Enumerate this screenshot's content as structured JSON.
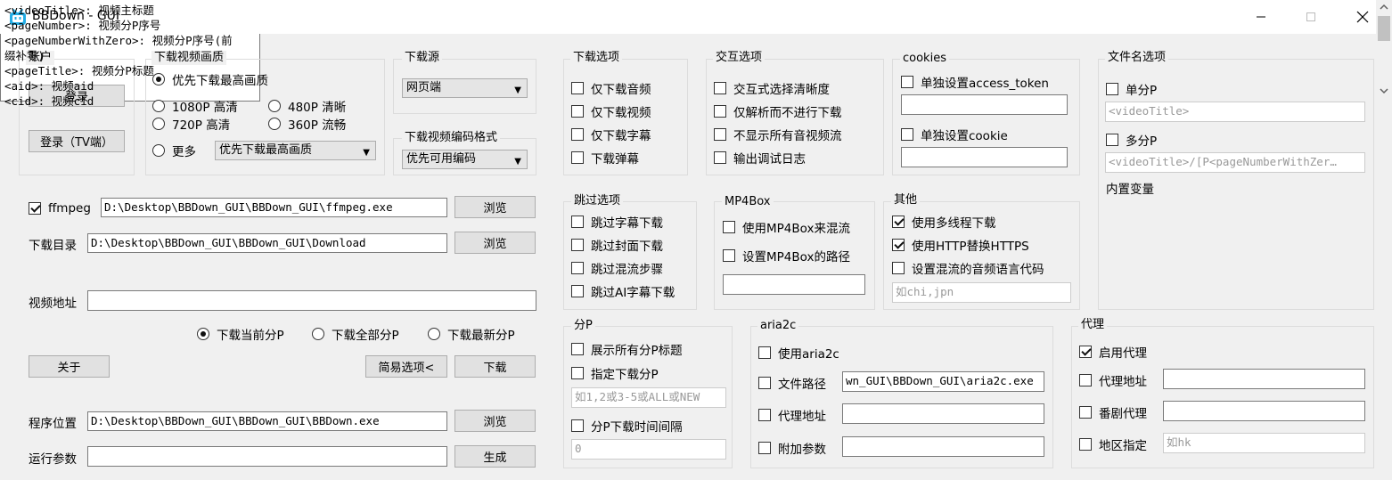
{
  "window": {
    "title": "BBDown - GUI",
    "min_icon": "─",
    "max_icon": "☐",
    "close_icon": "✕"
  },
  "account": {
    "legend": "账户",
    "login": "登录",
    "login_tv": "登录（TV端）"
  },
  "quality": {
    "legend": "下载视频画质",
    "highest": "优先下载最高画质",
    "q1080": "1080P 高清",
    "q720": "720P 高清",
    "q480": "480P 清晰",
    "q360": "360P 流畅",
    "more": "更多",
    "more_select": "优先下载最高画质"
  },
  "source": {
    "legend": "下载源",
    "value": "网页端"
  },
  "codec": {
    "legend": "下载视频编码格式",
    "value": "优先可用编码"
  },
  "ffmpeg": {
    "label": "ffmpeg",
    "path": "D:\\Desktop\\BBDown_GUI\\BBDown_GUI\\ffmpeg.exe",
    "browse": "浏览"
  },
  "download_dir": {
    "label": "下载目录",
    "path": "D:\\Desktop\\BBDown_GUI\\BBDown_GUI\\Download",
    "browse": "浏览"
  },
  "video_url": {
    "label": "视频地址",
    "value": ""
  },
  "page_mode": {
    "current": "下载当前分P",
    "all": "下载全部分P",
    "latest": "下载最新分P"
  },
  "buttons": {
    "about": "关于",
    "simple": "简易选项<",
    "download": "下载"
  },
  "program": {
    "label": "程序位置",
    "path": "D:\\Desktop\\BBDown_GUI\\BBDown_GUI\\BBDown.exe",
    "browse": "浏览"
  },
  "args": {
    "label": "运行参数",
    "value": "",
    "generate": "生成"
  },
  "download_opts": {
    "legend": "下载选项",
    "audio_only": "仅下载音频",
    "video_only": "仅下载视频",
    "sub_only": "仅下载字幕",
    "danmaku": "下载弹幕"
  },
  "interactive": {
    "legend": "交互选项",
    "choose_quality": "交互式选择清晰度",
    "parse_only": "仅解析而不进行下载",
    "hide_streams": "不显示所有音视频流",
    "debug_log": "输出调试日志"
  },
  "cookies": {
    "legend": "cookies",
    "access_token": "单独设置access_token",
    "cookie": "单独设置cookie"
  },
  "filename": {
    "legend": "文件名选项",
    "single": "单分P",
    "single_pattern": "<videoTitle>",
    "multi": "多分P",
    "multi_pattern": "<videoTitle>/[P<pageNumberWithZer…",
    "vars_label": "内置变量",
    "vars_text": "<videoTitle>: 视频主标题\n<pageNumber>: 视频分P序号\n<pageNumberWithZero>: 视频分P序号(前缀补零)\n<pageTitle>: 视频分P标题\n<aid>: 视频aid\n<cid>: 视频cid"
  },
  "skip": {
    "legend": "跳过选项",
    "sub": "跳过字幕下载",
    "cover": "跳过封面下载",
    "mux": "跳过混流步骤",
    "ai_sub": "跳过AI字幕下载"
  },
  "mp4box": {
    "legend": "MP4Box",
    "use": "使用MP4Box来混流",
    "set_path": "设置MP4Box的路径"
  },
  "other": {
    "legend": "其他",
    "multithread": "使用多线程下载",
    "http": "使用HTTP替换HTTPS",
    "audio_lang": "设置混流的音频语言代码",
    "audio_lang_placeholder": "如chi,jpn"
  },
  "pages": {
    "legend": "分P",
    "show_titles": "展示所有分P标题",
    "specify": "指定下载分P",
    "specify_placeholder": "如1,2或3-5或ALL或NEW",
    "interval": "分P下载时间间隔",
    "interval_placeholder": "0"
  },
  "aria2c": {
    "legend": "aria2c",
    "use": "使用aria2c",
    "file_path": "文件路径",
    "file_path_value": "wn_GUI\\BBDown_GUI\\aria2c.exe",
    "proxy": "代理地址",
    "extra_args": "附加参数"
  },
  "proxy": {
    "legend": "代理",
    "enable": "启用代理",
    "address": "代理地址",
    "bangumi": "番剧代理",
    "region": "地区指定",
    "region_placeholder": "如hk"
  }
}
